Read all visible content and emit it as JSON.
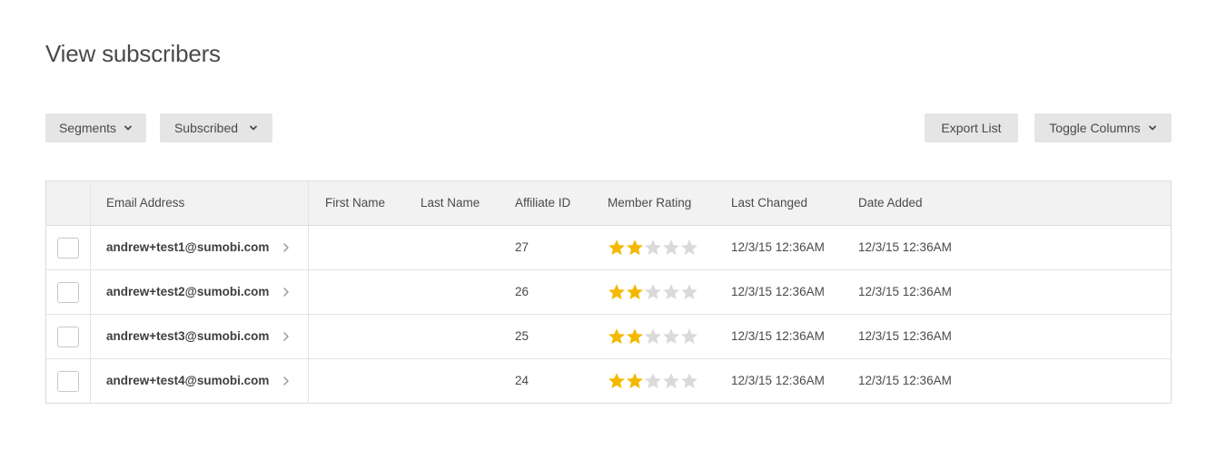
{
  "page": {
    "title": "View subscribers"
  },
  "toolbar": {
    "segments_label": "Segments",
    "subscribed_label": "Subscribed",
    "export_label": "Export List",
    "toggle_columns_label": "Toggle Columns"
  },
  "colors": {
    "star_filled": "#f5b800",
    "star_empty": "#dadada",
    "button_bg": "#e5e5e5"
  },
  "table": {
    "headers": {
      "email": "Email Address",
      "first_name": "First Name",
      "last_name": "Last Name",
      "affiliate_id": "Affiliate ID",
      "member_rating": "Member Rating",
      "last_changed": "Last Changed",
      "date_added": "Date Added"
    },
    "rows": [
      {
        "email": "andrew+test1@sumobi.com",
        "first_name": "",
        "last_name": "",
        "affiliate_id": "27",
        "rating": 2,
        "rating_max": 5,
        "last_changed": "12/3/15 12:36AM",
        "date_added": "12/3/15 12:36AM"
      },
      {
        "email": "andrew+test2@sumobi.com",
        "first_name": "",
        "last_name": "",
        "affiliate_id": "26",
        "rating": 2,
        "rating_max": 5,
        "last_changed": "12/3/15 12:36AM",
        "date_added": "12/3/15 12:36AM"
      },
      {
        "email": "andrew+test3@sumobi.com",
        "first_name": "",
        "last_name": "",
        "affiliate_id": "25",
        "rating": 2,
        "rating_max": 5,
        "last_changed": "12/3/15 12:36AM",
        "date_added": "12/3/15 12:36AM"
      },
      {
        "email": "andrew+test4@sumobi.com",
        "first_name": "",
        "last_name": "",
        "affiliate_id": "24",
        "rating": 2,
        "rating_max": 5,
        "last_changed": "12/3/15 12:36AM",
        "date_added": "12/3/15 12:36AM"
      }
    ]
  }
}
